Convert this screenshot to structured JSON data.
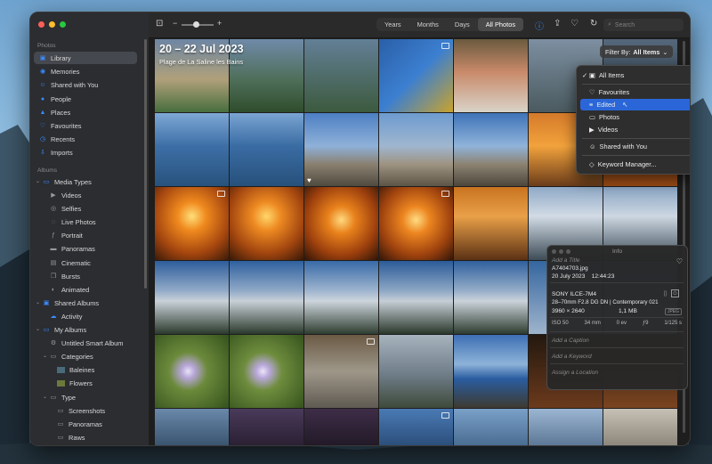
{
  "sidebar": {
    "section_photos": "Photos",
    "photos_items": [
      {
        "label": "Library",
        "icon": "library-icon"
      },
      {
        "label": "Memories",
        "icon": "memories-icon"
      },
      {
        "label": "Shared with You",
        "icon": "shared-with-you-icon"
      },
      {
        "label": "People",
        "icon": "people-icon"
      },
      {
        "label": "Places",
        "icon": "places-icon"
      },
      {
        "label": "Favourites",
        "icon": "heart-icon"
      },
      {
        "label": "Recents",
        "icon": "clock-icon"
      },
      {
        "label": "Imports",
        "icon": "import-icon"
      }
    ],
    "section_albums": "Albums",
    "media_types": {
      "label": "Media Types",
      "items": [
        "Videos",
        "Selfies",
        "Live Photos",
        "Portrait",
        "Panoramas",
        "Cinematic",
        "Bursts",
        "Animated"
      ]
    },
    "shared_albums": {
      "label": "Shared Albums",
      "items": [
        "Activity"
      ]
    },
    "my_albums": {
      "label": "My Albums",
      "items": [
        "Untitled Smart Album"
      ]
    },
    "categories": {
      "label": "Categories",
      "items": [
        "Baleines",
        "Flowers"
      ]
    },
    "type": {
      "label": "Type",
      "items": [
        "Screenshots",
        "Panoramas",
        "Raws"
      ]
    }
  },
  "toolbar": {
    "zoom_minus": "−",
    "zoom_plus": "+",
    "views": [
      "Years",
      "Months",
      "Days",
      "All Photos"
    ],
    "active_view": "All Photos",
    "search_placeholder": "Search"
  },
  "header": {
    "date_range": "20 – 22 Jul 2023",
    "location": "Plage de La Saline les Bains"
  },
  "filter": {
    "button_label": "Filter By:",
    "value": "All Items",
    "menu": [
      {
        "label": "All Items",
        "checked": true,
        "icon": "photos-videos-icon"
      },
      {
        "label": "Favourites",
        "icon": "heart-icon"
      },
      {
        "label": "Edited",
        "icon": "edited-icon",
        "highlighted": true
      },
      {
        "label": "Photos",
        "icon": "photo-icon"
      },
      {
        "label": "Videos",
        "icon": "video-icon"
      },
      {
        "label": "Shared with You",
        "icon": "shared-with-you-icon"
      },
      {
        "label": "Keyword Manager...",
        "icon": "tag-icon"
      }
    ]
  },
  "info": {
    "title": "Info",
    "add_title": "Add a Title",
    "filename": "A7404703.jpg",
    "datetime": "20 July 2023    12:44:23",
    "camera": "SONY ILCE-7M4",
    "lens": "28–70mm F2.8 DG DN | Contemporary 021",
    "dimensions": "3960 × 2640",
    "size": "1,1 MB",
    "format": "JPEG",
    "exif": [
      "ISO 50",
      "34 mm",
      "0 ev",
      "ƒ9",
      "1/125 s"
    ],
    "add_caption": "Add a Caption",
    "add_keyword": "Add a Keyword",
    "assign_location": "Assign a Location"
  },
  "colors": {
    "accent": "#3d8cff",
    "highlight": "#2a66d8"
  }
}
